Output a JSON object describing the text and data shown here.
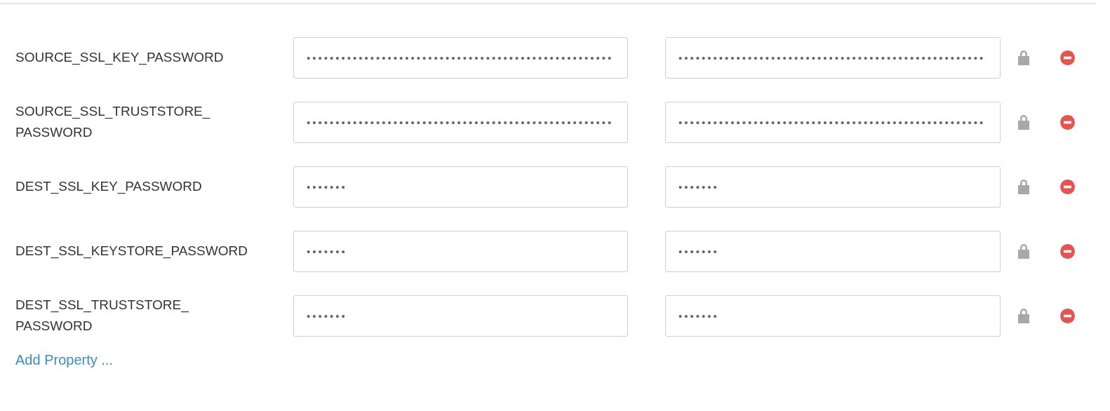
{
  "properties": [
    {
      "name": "SOURCE_SSL_KEY_PASSWORD",
      "value": "•••••••••••••••••••••••••••••••••••••••••••••••••••••",
      "encrypted_value": "•••••••••••••••••••••••••••••••••••••••••••••••••••••"
    },
    {
      "name": "SOURCE_SSL_TRUSTSTORE_ PASSWORD",
      "value": "•••••••••••••••••••••••••••••••••••••••••••••••••••••",
      "encrypted_value": "•••••••••••••••••••••••••••••••••••••••••••••••••••••"
    },
    {
      "name": "DEST_SSL_KEY_PASSWORD",
      "value": "•••••••",
      "encrypted_value": "•••••••"
    },
    {
      "name": "DEST_SSL_KEYSTORE_PASSWORD",
      "value": "•••••••",
      "encrypted_value": "•••••••"
    },
    {
      "name": "DEST_SSL_TRUSTSTORE_ PASSWORD",
      "value": "•••••••",
      "encrypted_value": "•••••••"
    }
  ],
  "add_link": "Add Property ..."
}
